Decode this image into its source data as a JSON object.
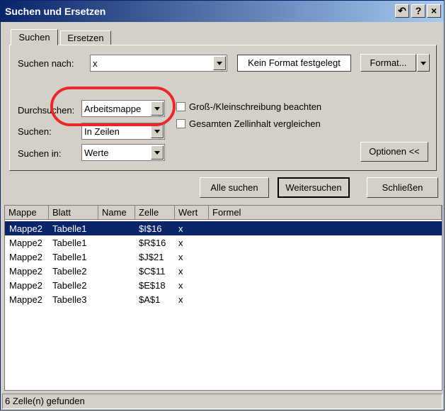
{
  "window": {
    "title": "Suchen und Ersetzen"
  },
  "titlebar_buttons": {
    "restore": "↶",
    "help": "?",
    "close": "×"
  },
  "tabs": [
    {
      "label": "Suchen",
      "active": true
    },
    {
      "label": "Ersetzen",
      "active": false
    }
  ],
  "search": {
    "label": "Suchen nach:",
    "value": "x",
    "format_display": "Kein Format festgelegt",
    "format_button": "Format..."
  },
  "options": {
    "within_label": "Durchsuchen:",
    "within_value": "Arbeitsmappe",
    "search_label": "Suchen:",
    "search_value": "In Zeilen",
    "lookin_label": "Suchen in:",
    "lookin_value": "Werte",
    "match_case": "Groß-/Kleinschreibung beachten",
    "match_entire": "Gesamten Zellinhalt vergleichen",
    "options_button": "Optionen <<"
  },
  "actions": {
    "find_all": "Alle suchen",
    "find_next": "Weitersuchen",
    "close": "Schließen"
  },
  "results": {
    "columns": [
      "Mappe",
      "Blatt",
      "Name",
      "Zelle",
      "Wert",
      "Formel"
    ],
    "rows": [
      {
        "mappe": "Mappe2",
        "blatt": "Tabelle1",
        "name": "",
        "zelle": "$I$16",
        "wert": "x",
        "formel": ""
      },
      {
        "mappe": "Mappe2",
        "blatt": "Tabelle1",
        "name": "",
        "zelle": "$R$16",
        "wert": "x",
        "formel": ""
      },
      {
        "mappe": "Mappe2",
        "blatt": "Tabelle1",
        "name": "",
        "zelle": "$J$21",
        "wert": "x",
        "formel": ""
      },
      {
        "mappe": "Mappe2",
        "blatt": "Tabelle2",
        "name": "",
        "zelle": "$C$11",
        "wert": "x",
        "formel": ""
      },
      {
        "mappe": "Mappe2",
        "blatt": "Tabelle2",
        "name": "",
        "zelle": "$E$18",
        "wert": "x",
        "formel": ""
      },
      {
        "mappe": "Mappe2",
        "blatt": "Tabelle3",
        "name": "",
        "zelle": "$A$1",
        "wert": "x",
        "formel": ""
      }
    ]
  },
  "status": "6 Zelle(n) gefunden",
  "colors": {
    "selection": "#0a246a",
    "highlight_ring": "#e8282a",
    "dialog_bg": "#d4d0c8"
  }
}
